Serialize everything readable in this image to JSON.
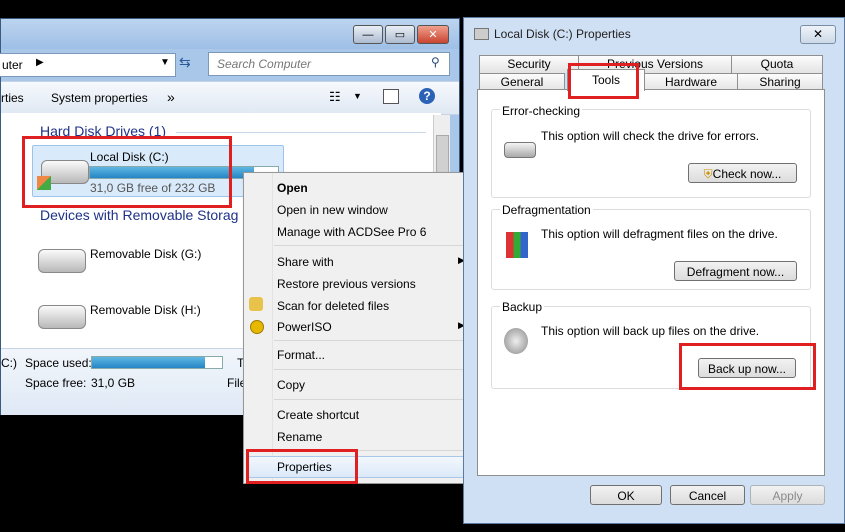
{
  "explorer": {
    "address_text": "uter",
    "search_placeholder": "Search Computer",
    "toolbar": {
      "properties_partial": "rties",
      "system_properties": "System properties",
      "more": "»"
    },
    "groups": {
      "hard_disk": "Hard Disk Drives (1)",
      "removable": "Devices with Removable Storag"
    },
    "drives": {
      "c": {
        "name": "Local Disk (C:)",
        "free": "31,0 GB free of 232 GB",
        "used_fraction": 0.87
      },
      "g": {
        "name": "Removable Disk (G:)"
      },
      "h": {
        "name": "Removable Disk (H:)"
      }
    },
    "details": {
      "drive_partial": "C:)",
      "space_used_label": "Space used:",
      "space_free_label": "Space free:",
      "space_free_value": "31,0 GB",
      "trunc_t": "T",
      "trunc_file": "File",
      "used_fraction": 0.87
    }
  },
  "context_menu": {
    "items": {
      "open": "Open",
      "open_new_window": "Open in new window",
      "manage_acdsee": "Manage with ACDSee Pro 6",
      "share_with": "Share with",
      "restore": "Restore previous versions",
      "scan_deleted": "Scan for deleted files",
      "poweriso": "PowerISO",
      "format": "Format...",
      "copy": "Copy",
      "create_shortcut": "Create shortcut",
      "rename": "Rename",
      "properties": "Properties"
    }
  },
  "dialog": {
    "title": "Local Disk (C:) Properties",
    "tabs": {
      "security": "Security",
      "previous_versions": "Previous Versions",
      "quota": "Quota",
      "general": "General",
      "tools": "Tools",
      "hardware": "Hardware",
      "sharing": "Sharing"
    },
    "error_checking": {
      "label": "Error-checking",
      "text": "This option will check the drive for errors.",
      "button": "Check now..."
    },
    "defrag": {
      "label": "Defragmentation",
      "text": "This option will defragment files on the drive.",
      "button": "Defragment now..."
    },
    "backup": {
      "label": "Backup",
      "text": "This option will back up files on the drive.",
      "button": "Back up now..."
    },
    "buttons": {
      "ok": "OK",
      "cancel": "Cancel",
      "apply": "Apply"
    }
  },
  "colors": {
    "highlight": "#e02020",
    "link_blue": "#1e3287",
    "bar_fill": "#2585c5"
  }
}
